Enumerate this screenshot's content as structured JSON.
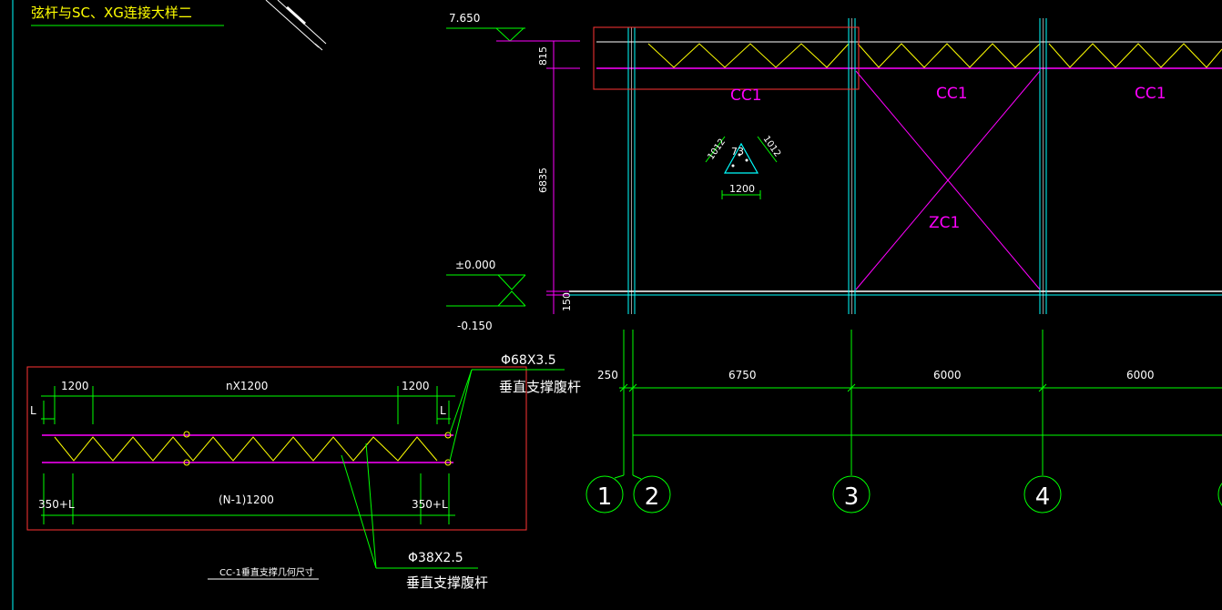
{
  "colors": {
    "background": "#000000",
    "dimension": "#00ff00",
    "column": "#00ffff",
    "truss_chord": "#ff00ff",
    "truss_web": "#ffff00",
    "text": "#ffffff",
    "highlight_box": "#ff3333",
    "member_label": "#ff00ff"
  },
  "labels": {
    "sheet_title": "弦杆与SC、XG连接大样二",
    "elev_top": "7.650",
    "elev_zero": "±0.000",
    "elev_neg": "-0.150",
    "dim_815": "815",
    "dim_6835": "6835",
    "dim_150": "150",
    "cc1_a": "CC1",
    "cc1_b": "CC1",
    "cc1_c": "CC1",
    "zc1": "ZC1",
    "tri_1012_left": "1012",
    "tri_1012_right": "1012",
    "tri_angle": "73",
    "tri_1200": "1200",
    "dim_250": "250",
    "dim_6750": "6750",
    "dim_6000_a": "6000",
    "dim_6000_b": "6000",
    "axis_1": "1",
    "axis_2": "2",
    "axis_3": "3",
    "axis_4": "4",
    "det_1200_left": "1200",
    "det_nx1200": "nX1200",
    "det_1200_right": "1200",
    "det_L_left": "L",
    "det_L_right": "L",
    "det_350L_left": "350+L",
    "det_n1_1200": "(N-1)1200",
    "det_350L_right": "350+L",
    "det_caption": "CC-1垂直支撑几何尺寸",
    "pipe_68": "Φ68X3.5",
    "pipe_68_desc": "垂直支撑腹杆",
    "pipe_38": "Φ38X2.5",
    "pipe_38_desc": "垂直支撑腹杆"
  }
}
